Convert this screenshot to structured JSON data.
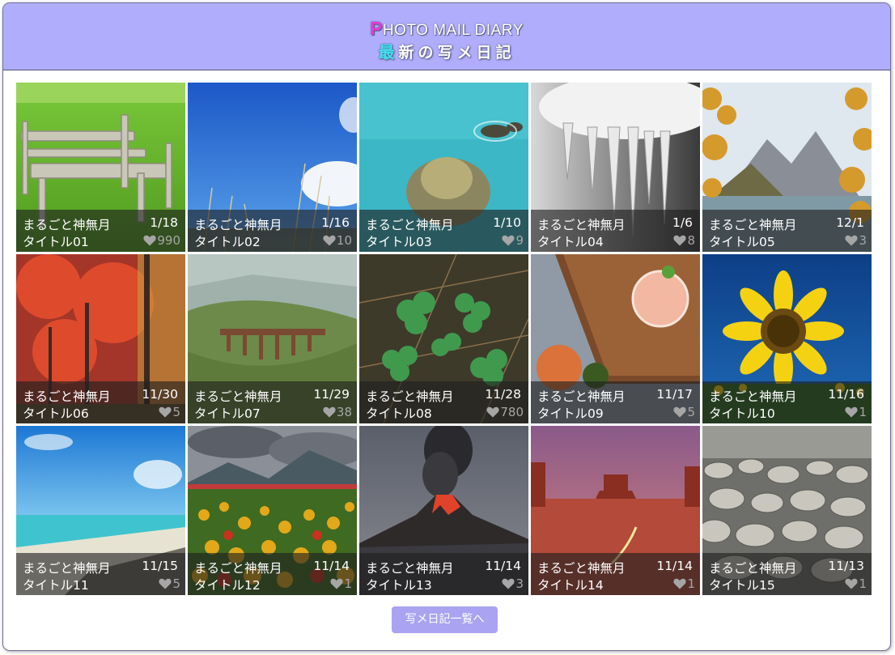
{
  "header": {
    "title_en_cap": "P",
    "title_en_rest": "HOTO MAIL DIARY",
    "title_jp_cap": "最",
    "title_jp_rest": "新の写メ日記",
    "accent_en": "#e63ad6",
    "accent_jp": "#3fe1f2"
  },
  "cards": [
    {
      "name": "まるごと神無月",
      "date": "1/18",
      "title": "タイトル01",
      "likes": "990",
      "photo": "bench-grass"
    },
    {
      "name": "まるごと神無月",
      "date": "1/16",
      "title": "タイトル02",
      "likes": "10",
      "photo": "blue-sky-grass"
    },
    {
      "name": "まるごと神無月",
      "date": "1/10",
      "title": "タイトル03",
      "likes": "9",
      "photo": "turquoise-sea-rock"
    },
    {
      "name": "まるごと神無月",
      "date": "1/6",
      "title": "タイトル04",
      "likes": "8",
      "photo": "icicles"
    },
    {
      "name": "まるごと神無月",
      "date": "12/1",
      "title": "タイトル05",
      "likes": "3",
      "photo": "mountain-lake-autumn"
    },
    {
      "name": "まるごと神無月",
      "date": "11/30",
      "title": "タイトル06",
      "likes": "5",
      "photo": "red-maple-forest"
    },
    {
      "name": "まるごと神無月",
      "date": "11/29",
      "title": "タイトル07",
      "likes": "38",
      "photo": "viaduct-valley"
    },
    {
      "name": "まるごと神無月",
      "date": "11/28",
      "title": "タイトル08",
      "likes": "780",
      "photo": "clover"
    },
    {
      "name": "まるごと神無月",
      "date": "11/17",
      "title": "タイトル09",
      "likes": "5",
      "photo": "drink-peach"
    },
    {
      "name": "まるごと神無月",
      "date": "11/16",
      "title": "タイトル10",
      "likes": "1",
      "photo": "sunflower"
    },
    {
      "name": "まるごと神無月",
      "date": "11/15",
      "title": "タイトル11",
      "likes": "5",
      "photo": "beach"
    },
    {
      "name": "まるごと神無月",
      "date": "11/14",
      "title": "タイトル12",
      "likes": "1",
      "photo": "tulip-field"
    },
    {
      "name": "まるごと神無月",
      "date": "11/14",
      "title": "タイトル13",
      "likes": "3",
      "photo": "volcano"
    },
    {
      "name": "まるごと神無月",
      "date": "11/14",
      "title": "タイトル14",
      "likes": "1",
      "photo": "desert-monuments"
    },
    {
      "name": "まるごと神無月",
      "date": "11/13",
      "title": "タイトル15",
      "likes": "1",
      "photo": "pebbles"
    }
  ],
  "footer": {
    "more_label": "写メ日記一覧へ"
  }
}
